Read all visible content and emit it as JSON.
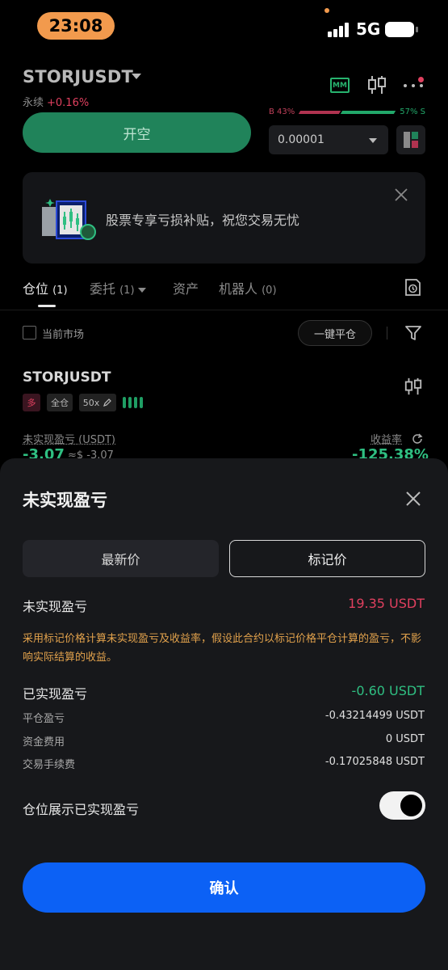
{
  "status_bar": {
    "time": "23:08",
    "network": "5G"
  },
  "header": {
    "symbol": "STORJUSDT",
    "contract_type": "永续",
    "change": "+0.16%",
    "mm_icon_text": "MM"
  },
  "trade": {
    "open_button": "开空",
    "buy_ratio": "B 43%",
    "sell_ratio": "57% S",
    "quantity": "0.00001"
  },
  "banner": {
    "text": "股票专享亏损补贴，祝您交易无忧"
  },
  "tabs": {
    "positions": "仓位",
    "positions_count": "(1)",
    "orders": "委托",
    "orders_count": "(1)",
    "assets": "资产",
    "bots": "机器人",
    "bots_count": "(0)"
  },
  "filters": {
    "current_market": "当前市场",
    "close_all": "一键平仓"
  },
  "position": {
    "symbol": "STORJUSDT",
    "side": "多",
    "margin_mode": "全仓",
    "leverage": "50x",
    "unrealized_label": "未实现盈亏 (USDT)",
    "roe_label": "收益率",
    "unrealized_value": "-3.07",
    "unrealized_usd": "≈$ -3.07",
    "roe_value": "-125.38%"
  },
  "sheet": {
    "title": "未实现盈亏",
    "seg_latest": "最新价",
    "seg_mark": "标记价",
    "unrealized_label": "未实现盈亏",
    "unrealized_value": "19.35 USDT",
    "note": "采用标记价格计算未实现盈亏及收益率，假设此合约以标记价格平仓计算的盈亏，不影响实际结算的收益。",
    "realized_label": "已实现盈亏",
    "realized_value": "-0.60 USDT",
    "close_pnl_label": "平仓盈亏",
    "close_pnl_value": "-0.43214499 USDT",
    "funding_label": "资金费用",
    "funding_value": "0 USDT",
    "fee_label": "交易手续费",
    "fee_value": "-0.17025848 USDT",
    "toggle_label": "仓位展示已实现盈亏",
    "toggle_on": true,
    "confirm": "确认"
  },
  "colors": {
    "green": "#2fbf82",
    "red": "#e0405f",
    "orange_note": "#e2a24c",
    "confirm_blue": "#0c61f5",
    "open_button": "#20835a"
  }
}
